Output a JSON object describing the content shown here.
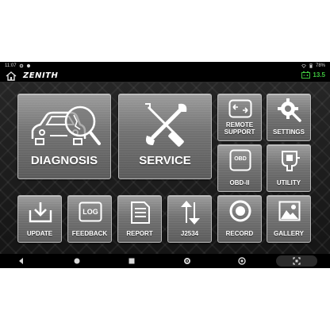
{
  "status_bar": {
    "time": "11:07",
    "battery_percent": "78%"
  },
  "header": {
    "logo_text": "ZENITH",
    "voltage": "13.5"
  },
  "tiles": {
    "diagnosis": "DIAGNOSIS",
    "service": "SERVICE",
    "remote_support_line1": "REMOTE",
    "remote_support_line2": "SUPPORT",
    "settings": "SETTINGS",
    "obd2": "OBD-II",
    "obd_icon_text": "OBD",
    "utility": "UTILITY",
    "update": "UPDATE",
    "feedback": "FEEDBACK",
    "log_icon_text": "LOG",
    "report": "REPORT",
    "j2534": "J2534",
    "record": "RECORD",
    "gallery": "GALLERY"
  },
  "colors": {
    "voltage": "#3ec43e",
    "tile_border": "#b8b8b8"
  }
}
